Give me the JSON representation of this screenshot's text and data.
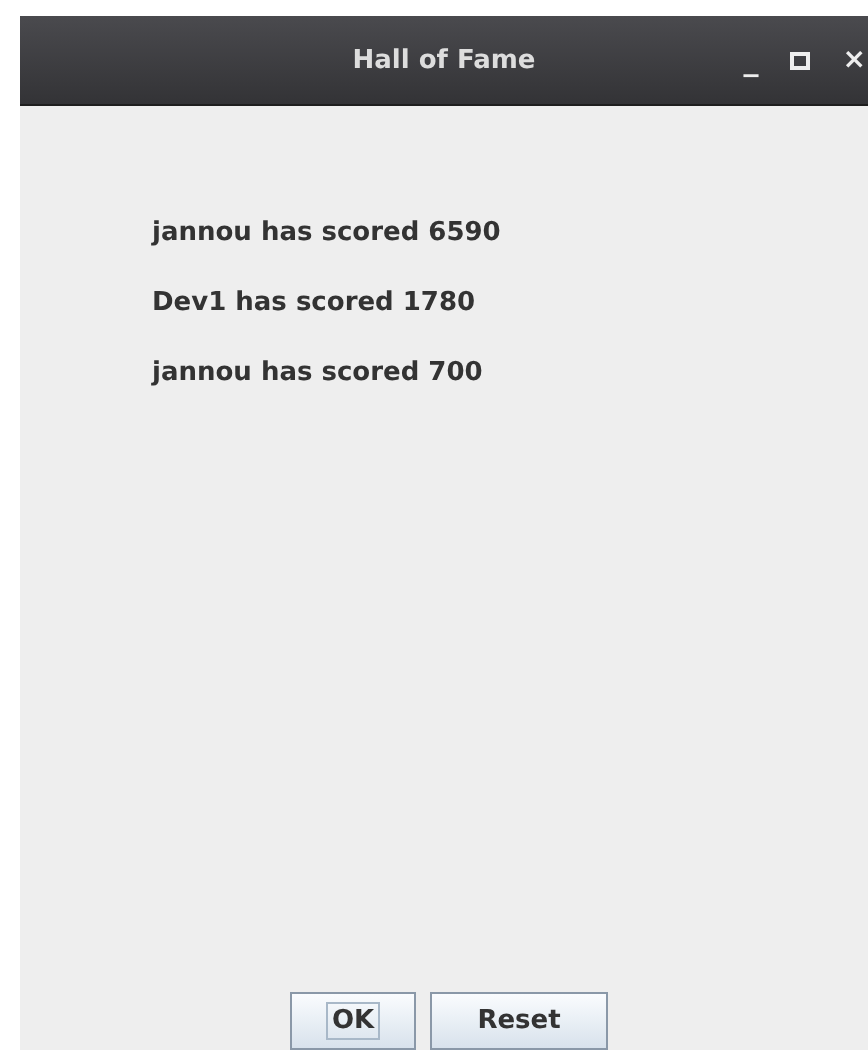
{
  "window": {
    "title": "Hall of Fame",
    "controls": [
      "_",
      "×"
    ]
  },
  "scores": [
    "jannou has scored 6590",
    "Dev1 has scored 1780",
    "jannou has scored 700"
  ],
  "buttons": [
    {
      "label": "OK",
      "focused": true
    },
    {
      "label": "Reset",
      "focused": false
    }
  ]
}
